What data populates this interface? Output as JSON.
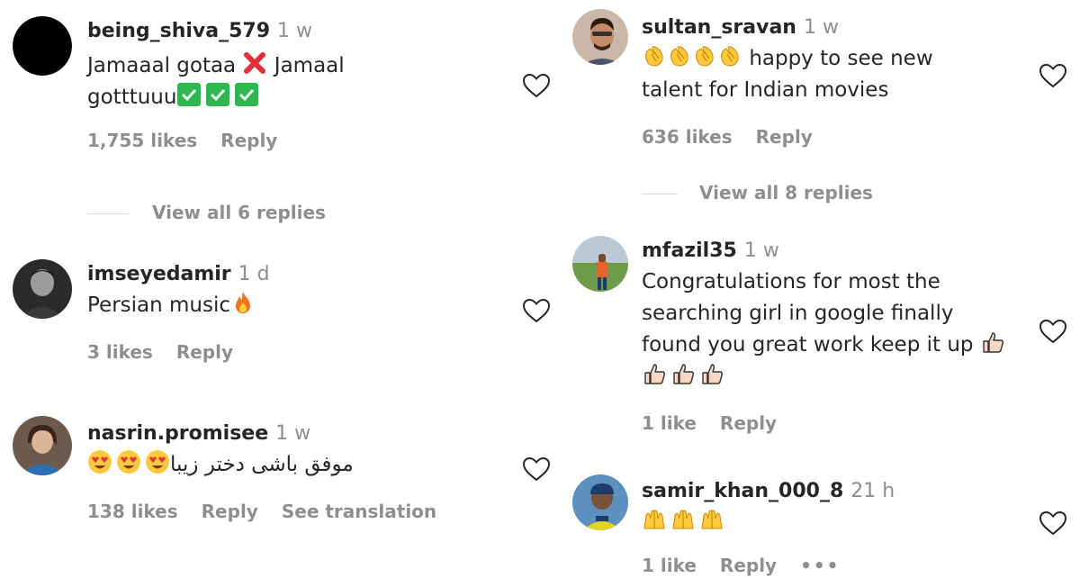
{
  "left_column": {
    "comments": [
      {
        "username": "being_shiva_579",
        "time": "1 w",
        "text_a": "Jamaaal gotaa",
        "text_b": "Jamaal",
        "text_c": "gotttuuu",
        "emojis": [
          "cross-mark-icon",
          "check-box-icon",
          "check-box-icon",
          "check-box-icon"
        ],
        "likes": "1,755 likes",
        "reply": "Reply",
        "view_replies": "View all 6 replies",
        "avatar_color": "#000000"
      },
      {
        "username": "imseyedamir",
        "time": "1 d",
        "text": "Persian music",
        "emojis": [
          "fire-icon"
        ],
        "likes": "3 likes",
        "reply": "Reply"
      },
      {
        "username": "nasrin.promisee",
        "time": "1 w",
        "text": "موفق باشی دختر زیبا",
        "emojis": [
          "heart-eyes-face-icon",
          "heart-eyes-face-icon",
          "heart-eyes-face-icon"
        ],
        "likes": "138 likes",
        "reply": "Reply",
        "see_translation": "See translation"
      }
    ]
  },
  "right_column": {
    "comments": [
      {
        "username": "sultan_sravan",
        "time": "1 w",
        "emojis": [
          "clapping-hands-icon",
          "clapping-hands-icon",
          "clapping-hands-icon",
          "clapping-hands-icon"
        ],
        "text_a": "happy to see new",
        "text_b": "talent for Indian movies",
        "likes": "636 likes",
        "reply": "Reply",
        "view_replies": "View all 8 replies"
      },
      {
        "username": "mfazil35",
        "time": "1 w",
        "text_a": "Congratulations for most the",
        "text_b": "searching girl in google finally",
        "text_c": "found you great work keep it up",
        "emojis": [
          "thumbs-up-icon",
          "thumbs-up-icon",
          "thumbs-up-icon",
          "thumbs-up-icon"
        ],
        "likes": "1 like",
        "reply": "Reply"
      },
      {
        "username": "samir_khan_000_8",
        "time": "21 h",
        "emojis": [
          "raising-hands-icon",
          "raising-hands-icon",
          "raising-hands-icon"
        ],
        "likes": "1 like",
        "reply": "Reply"
      }
    ]
  },
  "colors": {
    "text": "#262626",
    "muted": "#8e8e8e",
    "check_green": "#2db84d",
    "cross_red": "#e0303a",
    "emoji_yellow": "#ffc83d"
  }
}
